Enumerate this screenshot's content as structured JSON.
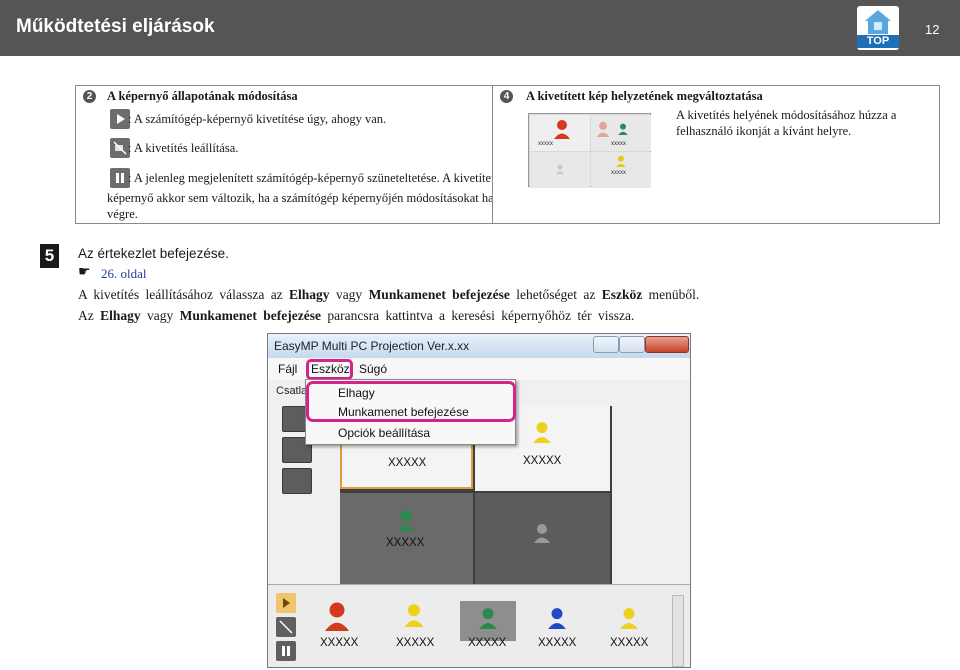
{
  "header": {
    "title": "Működtetési eljárások",
    "page_number": "12",
    "top_label": "TOP",
    "bg_color": "#555555"
  },
  "step2": {
    "number": "2",
    "heading": "A képernyő állapotának módosítása",
    "play_text": ": A számítógép-képernyő kivetítése úgy, ahogy van.",
    "stop_text": ": A kivetítés leállítása.",
    "pause_text": ": A jelenleg megjelenített számítógép-képernyő szüneteltetése. A kivetített",
    "pause_text2": "képernyő akkor sem változik, ha a számítógép képernyőjén módosításokat hajt",
    "pause_text3": "végre."
  },
  "step4": {
    "number": "4",
    "heading": "A kivetített kép helyzetének megváltoztatása",
    "desc1": "A kivetítés helyének módosításához húzza a",
    "desc2": "felhasználó ikonját a kívánt helyre.",
    "mini_labels": [
      "xxxxx",
      "xxxxx",
      "xxxxx"
    ]
  },
  "step5": {
    "number": "5",
    "heading": "Az értekezlet befejezése.",
    "ref_symbol": "☛",
    "ref_link": "26. oldal",
    "line1_parts": [
      "A kivetítés leállításához válassza az ",
      "Elhagy",
      " vagy ",
      "Munkamenet befejezése",
      " lehetőséget az ",
      "Eszköz",
      " menüből."
    ],
    "line2_parts": [
      "Az ",
      "Elhagy",
      " vagy ",
      "Munkamenet befejezése",
      " parancsra kattintva a keresési képernyőhöz tér vissza."
    ]
  },
  "app": {
    "title": "EasyMP Multi PC Projection Ver.x.xx",
    "menus": [
      "Fájl",
      "Eszköz",
      "Súgó"
    ],
    "toolbar_partial": "Csatlak",
    "dropdown_items": [
      "Elhagy",
      "Munkamenet befejezése",
      "Opciók beállítása"
    ],
    "stage_labels": [
      "XXXXX",
      "XXXXX",
      "XXXXX"
    ],
    "bottom_labels": [
      "XXXXX",
      "XXXXX",
      "XXXXX",
      "XXXXX",
      "XXXXX"
    ],
    "highlight_color": "#d4238a"
  }
}
